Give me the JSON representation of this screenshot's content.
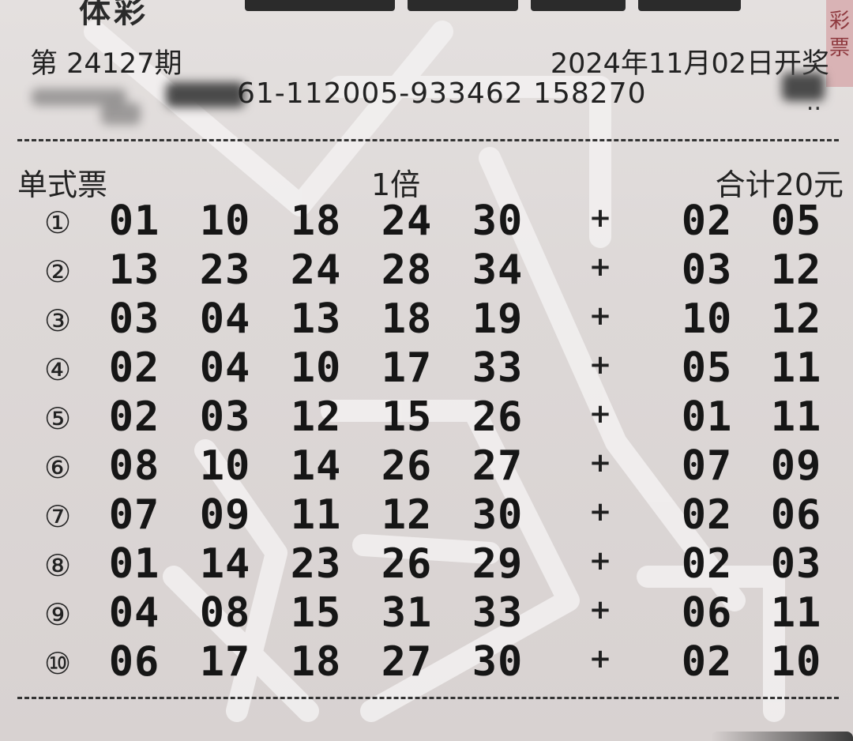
{
  "header": {
    "logo_partial": "体彩",
    "edge_tab": "彩 票"
  },
  "ticket": {
    "issue": "第 24127期",
    "draw_date": "2024年11月02日开奖",
    "serial": "61-112005-933462 158270",
    "serial_tail": ".."
  },
  "summary": {
    "ticket_type": "单式票",
    "multiplier": "1倍",
    "total": "合计20元"
  },
  "bets": [
    {
      "label": "①",
      "front": [
        "01",
        "10",
        "18",
        "24",
        "30"
      ],
      "plus": "+",
      "back": [
        "02",
        "05"
      ]
    },
    {
      "label": "②",
      "front": [
        "13",
        "23",
        "24",
        "28",
        "34"
      ],
      "plus": "+",
      "back": [
        "03",
        "12"
      ]
    },
    {
      "label": "③",
      "front": [
        "03",
        "04",
        "13",
        "18",
        "19"
      ],
      "plus": "+",
      "back": [
        "10",
        "12"
      ]
    },
    {
      "label": "④",
      "front": [
        "02",
        "04",
        "10",
        "17",
        "33"
      ],
      "plus": "+",
      "back": [
        "05",
        "11"
      ]
    },
    {
      "label": "⑤",
      "front": [
        "02",
        "03",
        "12",
        "15",
        "26"
      ],
      "plus": "+",
      "back": [
        "01",
        "11"
      ]
    },
    {
      "label": "⑥",
      "front": [
        "08",
        "10",
        "14",
        "26",
        "27"
      ],
      "plus": "+",
      "back": [
        "07",
        "09"
      ]
    },
    {
      "label": "⑦",
      "front": [
        "07",
        "09",
        "11",
        "12",
        "30"
      ],
      "plus": "+",
      "back": [
        "02",
        "06"
      ]
    },
    {
      "label": "⑧",
      "front": [
        "01",
        "14",
        "23",
        "26",
        "29"
      ],
      "plus": "+",
      "back": [
        "02",
        "03"
      ]
    },
    {
      "label": "⑨",
      "front": [
        "04",
        "08",
        "15",
        "31",
        "33"
      ],
      "plus": "+",
      "back": [
        "06",
        "11"
      ]
    },
    {
      "label": "⑩",
      "front": [
        "06",
        "17",
        "18",
        "27",
        "30"
      ],
      "plus": "+",
      "back": [
        "02",
        "10"
      ]
    }
  ],
  "colors": {
    "paper": "#e4e0df",
    "ink": "#161616",
    "watermark": "#f2f0f0"
  }
}
